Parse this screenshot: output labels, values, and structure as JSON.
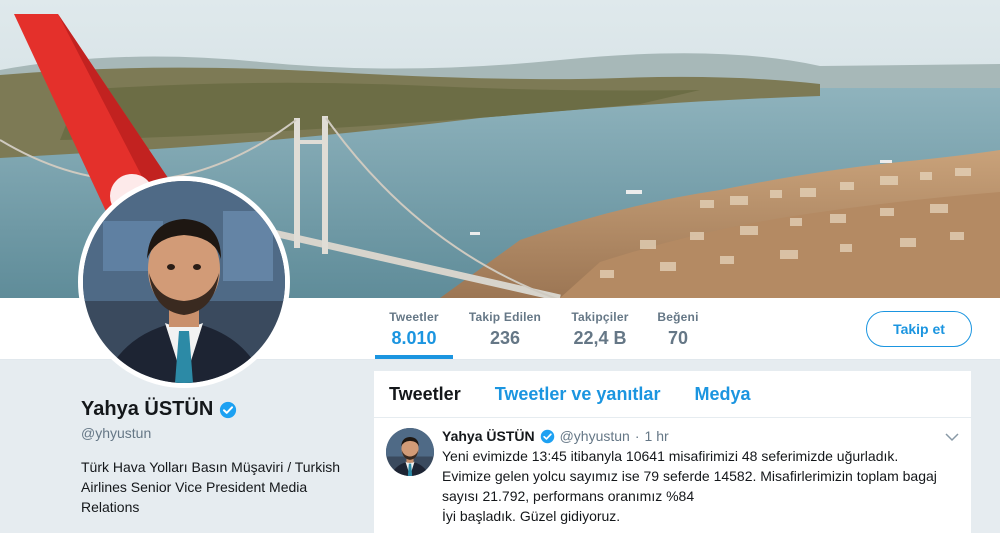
{
  "profile": {
    "name": "Yahya ÜSTÜN",
    "handle": "@yhyustun",
    "bio": "Türk Hava Yolları Basın Müşaviri / Turkish Airlines Senior Vice President Media Relations",
    "verified_icon": "verified-badge-icon"
  },
  "stats": {
    "tweets": {
      "label": "Tweetler",
      "value": "8.010"
    },
    "following": {
      "label": "Takip Edilen",
      "value": "236"
    },
    "followers": {
      "label": "Takipçiler",
      "value": "22,4 B"
    },
    "likes": {
      "label": "Beğeni",
      "value": "70"
    }
  },
  "follow_button": {
    "label": "Takip et"
  },
  "tabs": [
    {
      "label": "Tweetler"
    },
    {
      "label": "Tweetler ve yanıtlar"
    },
    {
      "label": "Medya"
    }
  ],
  "tweet": {
    "author": "Yahya ÜSTÜN",
    "handle": "@yhyustun",
    "separator": "·",
    "time": "1 hr",
    "lines": [
      "Yeni evimizde 13:45 itibanyla 10641 misafirimizi 48 seferimizde uğurladık.",
      "Evimize gelen yolcu sayımız ise 79 seferde 14582. Misafirlerimizin toplam bagaj",
      "sayısı 21.792, performans oranımız %84",
      "İyi başladık. Güzel gidiyoruz."
    ]
  },
  "colors": {
    "accent": "#1b95e0",
    "background": "#e6ecf0",
    "muted_text": "#657786",
    "tail_red": "#e4302b"
  }
}
